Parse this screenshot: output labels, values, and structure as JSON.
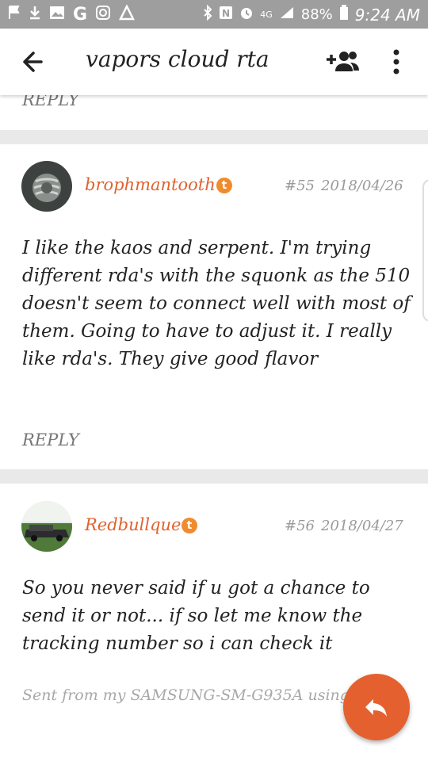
{
  "status_bar": {
    "left_icons": [
      "flag-icon",
      "download-icon",
      "image-icon",
      "google-icon",
      "instagram-icon",
      "tapatalk-icon"
    ],
    "battery": "88%",
    "time": "9:24 AM"
  },
  "toolbar": {
    "title": "vapors cloud rta"
  },
  "top_reply_label": "REPLY",
  "posts": [
    {
      "author": "brophmantooth",
      "badge": "t",
      "number": "#55",
      "date": "2018/04/26",
      "body": "I like the kaos and serpent. I'm trying different rda's with the squonk as the 510 doesn't seem to connect well with most of them. Going to have to adjust it. I really like rda's. They give good flavor",
      "reply_label": "REPLY"
    },
    {
      "author": "Redbullque",
      "badge": "t",
      "number": "#56",
      "date": "2018/04/27",
      "body": "So you never said if u got a chance to send it or not... if so let me know the tracking number so i can check it",
      "signature": "Sent from my SAMSUNG-SM-G935A using Ta"
    }
  ],
  "colors": {
    "accent": "#e4612f",
    "author": "#e0622e",
    "badge": "#f08c2e",
    "statusbar": "#9e9e9e"
  }
}
